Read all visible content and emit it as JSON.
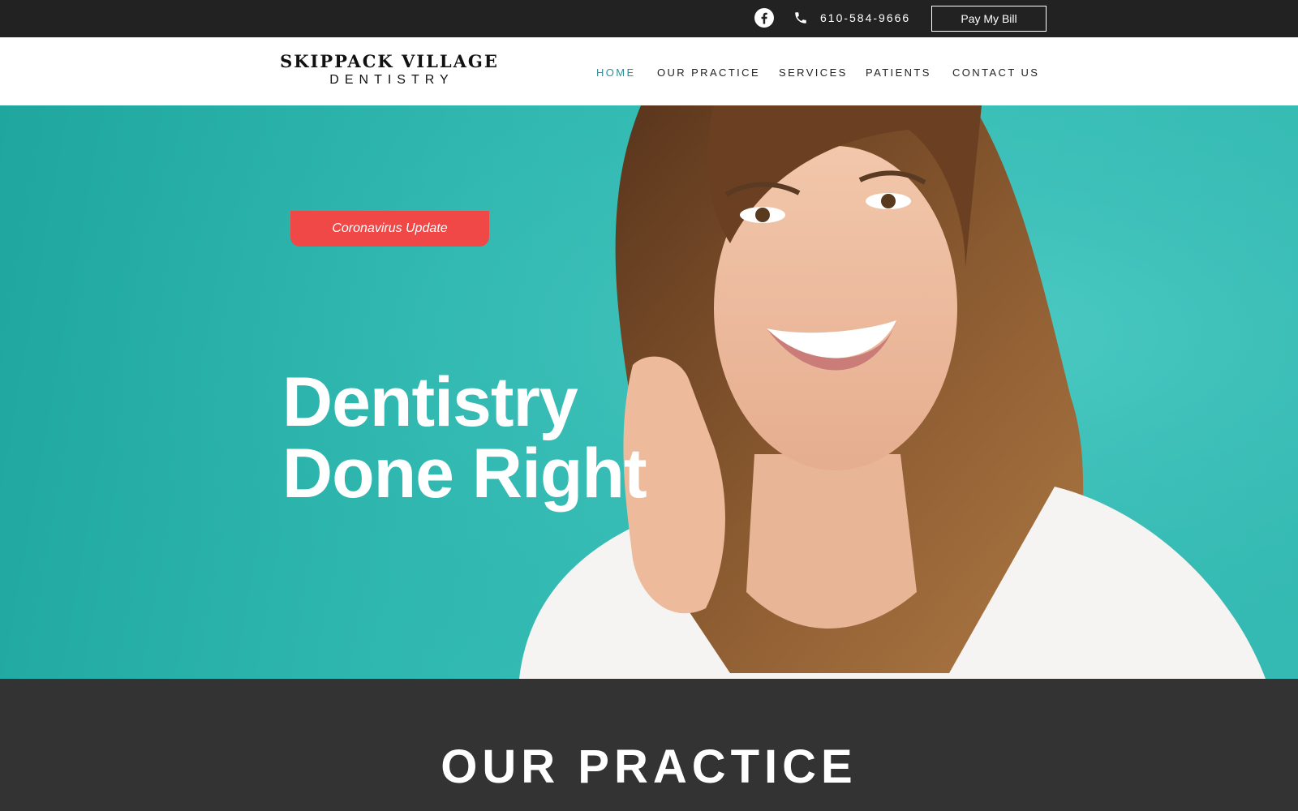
{
  "topbar": {
    "facebook_icon": "facebook-icon",
    "phone_icon": "phone-icon",
    "phone_number": "610-584-9666",
    "pay_bill_label": "Pay My Bill"
  },
  "header": {
    "logo_line1": "SKIPPACK VILLAGE",
    "logo_line2": "DENTISTRY",
    "nav": [
      {
        "label": "HOME",
        "active": true
      },
      {
        "label": "OUR PRACTICE",
        "active": false
      },
      {
        "label": "SERVICES",
        "active": false
      },
      {
        "label": "PATIENTS",
        "active": false
      },
      {
        "label": "CONTACT US",
        "active": false
      }
    ]
  },
  "hero": {
    "announcement_label": "Coronavirus Update",
    "headline_line1": "Dentistry",
    "headline_line2": "Done Right"
  },
  "practice": {
    "title": "OUR PRACTICE"
  },
  "colors": {
    "topbar_bg": "#222222",
    "nav_active": "#2c8f9a",
    "hero_bg": "#33b9b1",
    "announcement_bg": "#f04747",
    "section_bg": "#333333"
  }
}
